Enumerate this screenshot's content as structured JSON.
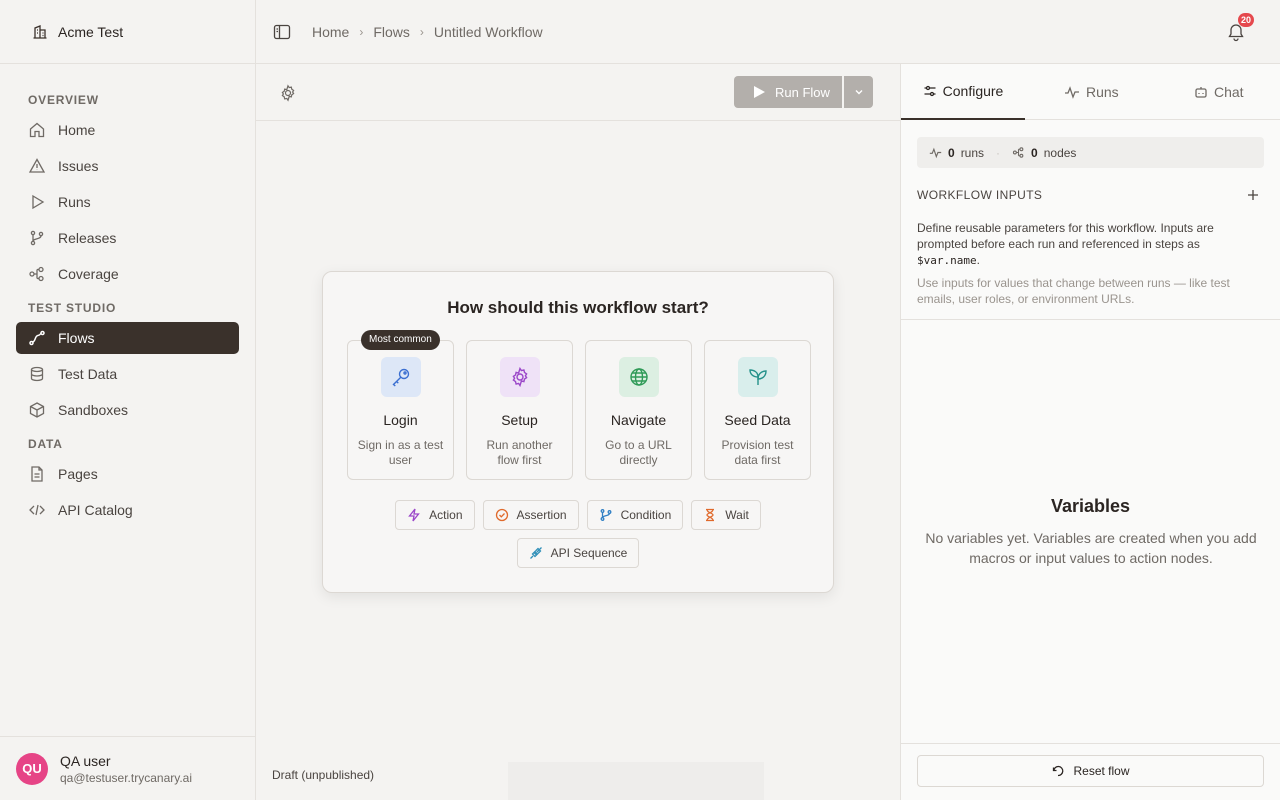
{
  "workspace": {
    "name": "Acme Test"
  },
  "sidebar": {
    "sections": [
      {
        "title": "OVERVIEW",
        "items": [
          {
            "label": "Home",
            "icon": "home-icon"
          },
          {
            "label": "Issues",
            "icon": "warning-icon"
          },
          {
            "label": "Runs",
            "icon": "play-icon"
          },
          {
            "label": "Releases",
            "icon": "git-branch-icon"
          },
          {
            "label": "Coverage",
            "icon": "network-icon"
          }
        ]
      },
      {
        "title": "TEST STUDIO",
        "items": [
          {
            "label": "Flows",
            "icon": "flow-icon",
            "active": true
          },
          {
            "label": "Test Data",
            "icon": "database-icon"
          },
          {
            "label": "Sandboxes",
            "icon": "box-icon"
          }
        ]
      },
      {
        "title": "DATA",
        "items": [
          {
            "label": "Pages",
            "icon": "file-icon"
          },
          {
            "label": "API Catalog",
            "icon": "code-icon"
          }
        ]
      }
    ]
  },
  "user": {
    "initials": "QU",
    "name": "QA user",
    "email": "qa@testuser.trycanary.ai"
  },
  "breadcrumb": [
    "Home",
    "Flows",
    "Untitled Workflow"
  ],
  "notifications": {
    "count": "20"
  },
  "toolbar": {
    "run_label": "Run Flow"
  },
  "start": {
    "title": "How should this workflow start?",
    "badge": "Most common",
    "options": [
      {
        "title": "Login",
        "desc": "Sign in as a test user",
        "icon": "key-icon"
      },
      {
        "title": "Setup",
        "desc": "Run another flow first",
        "icon": "gear-icon"
      },
      {
        "title": "Navigate",
        "desc": "Go to a URL directly",
        "icon": "globe-icon"
      },
      {
        "title": "Seed Data",
        "desc": "Provision test data first",
        "icon": "sprout-icon"
      }
    ],
    "chips": [
      {
        "label": "Action",
        "icon": "bolt-icon"
      },
      {
        "label": "Assertion",
        "icon": "check-circle-icon"
      },
      {
        "label": "Condition",
        "icon": "branch-icon"
      },
      {
        "label": "Wait",
        "icon": "hourglass-icon"
      },
      {
        "label": "API Sequence",
        "icon": "plug-icon"
      }
    ]
  },
  "status": {
    "label": "Draft (unpublished)"
  },
  "panel": {
    "tabs": [
      "Configure",
      "Runs",
      "Chat"
    ],
    "stats": {
      "runs_count": "0",
      "runs_label": "runs",
      "nodes_count": "0",
      "nodes_label": "nodes"
    },
    "inputs": {
      "heading": "WORKFLOW INPUTS",
      "desc": "Define reusable parameters for this workflow. Inputs are prompted before each run and referenced in steps as",
      "code": "$var.name",
      "desc_end": ".",
      "hint": "Use inputs for values that change between runs — like test emails, user roles, or environment URLs."
    },
    "variables": {
      "title": "Variables",
      "desc": "No variables yet. Variables are created when you add macros or input values to action nodes."
    },
    "reset_label": "Reset flow"
  },
  "colors": {
    "accent": "#3a312b",
    "avatar": "#e64486",
    "badge": "#e5484d"
  }
}
